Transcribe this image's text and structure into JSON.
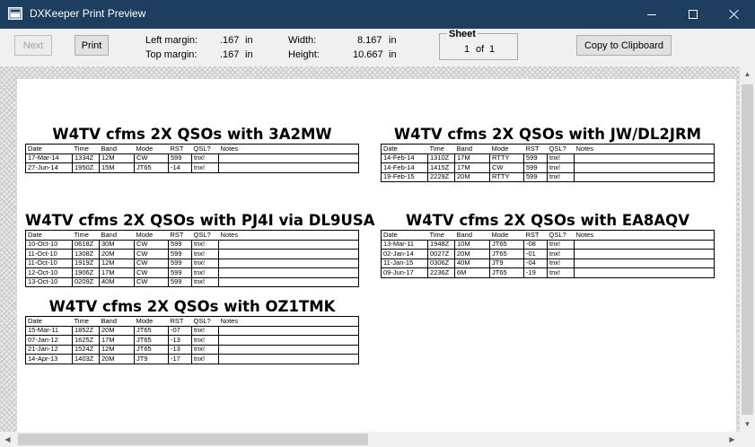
{
  "window": {
    "title": "DXKeeper Print Preview"
  },
  "toolbar": {
    "next_label": "Next",
    "print_label": "Print",
    "copy_label": "Copy to Clipboard",
    "left_margin_label": "Left margin:",
    "left_margin_value": ".167",
    "top_margin_label": "Top margin:",
    "top_margin_value": ".167",
    "width_label": "Width:",
    "width_value": "8.167",
    "height_label": "Height:",
    "height_value": "10.667",
    "unit": "in",
    "sheet_label": "Sheet",
    "sheet_current": "1",
    "sheet_of": "of",
    "sheet_total": "1"
  },
  "columns": [
    "Date",
    "Time",
    "Band",
    "Mode",
    "RST",
    "QSL?",
    "Notes"
  ],
  "qsls": [
    {
      "title": "W4TV cfms 2X QSOs with 3A2MW",
      "rows": [
        [
          "17-Mar-14",
          "1334Z",
          "12M",
          "CW",
          "599",
          "tnx!",
          ""
        ],
        [
          "27-Jun-14",
          "1950Z",
          "15M",
          "JT65",
          "-14",
          "tnx!",
          ""
        ]
      ]
    },
    {
      "title": "W4TV cfms 2X QSOs with JW/DL2JRM",
      "rows": [
        [
          "14-Feb-14",
          "1310Z",
          "17M",
          "RTTY",
          "599",
          "tnx!",
          ""
        ],
        [
          "14-Feb-14",
          "1415Z",
          "17M",
          "CW",
          "599",
          "tnx!",
          ""
        ],
        [
          "19-Feb-15",
          "2229Z",
          "20M",
          "RTTY",
          "599",
          "tnx!",
          ""
        ]
      ]
    },
    {
      "title": "W4TV cfms 2X QSOs with PJ4I via DL9USA",
      "rows": [
        [
          "10-Oct-10",
          "0618Z",
          "30M",
          "CW",
          "599",
          "tnx!",
          ""
        ],
        [
          "11-Oct-10",
          "1308Z",
          "20M",
          "CW",
          "599",
          "tnx!",
          ""
        ],
        [
          "11-Oct-10",
          "1919Z",
          "12M",
          "CW",
          "599",
          "tnx!",
          ""
        ],
        [
          "12-Oct-10",
          "1906Z",
          "17M",
          "CW",
          "599",
          "tnx!",
          ""
        ],
        [
          "13-Oct-10",
          "0209Z",
          "40M",
          "CW",
          "599",
          "tnx!",
          ""
        ]
      ]
    },
    {
      "title": "W4TV cfms 2X QSOs with EA8AQV",
      "rows": [
        [
          "13-Mar-11",
          "1948Z",
          "10M",
          "JT65",
          "-08",
          "tnx!",
          ""
        ],
        [
          "02-Jan-14",
          "0027Z",
          "20M",
          "JT65",
          "-01",
          "tnx!",
          ""
        ],
        [
          "11-Jan-15",
          "0306Z",
          "40M",
          "JT9",
          "-04",
          "tnx!",
          ""
        ],
        [
          "09-Jun-17",
          "2236Z",
          "6M",
          "JT65",
          "-19",
          "tnx!",
          ""
        ]
      ]
    },
    {
      "title": "W4TV cfms 2X QSOs with OZ1TMK",
      "rows": [
        [
          "15-Mar-11",
          "1852Z",
          "20M",
          "JT65",
          "-07",
          "tnx!",
          ""
        ],
        [
          "07-Jan-12",
          "1625Z",
          "17M",
          "JT65",
          "-13",
          "tnx!",
          ""
        ],
        [
          "21-Jan-12",
          "1524Z",
          "12M",
          "JT65",
          "-13",
          "tnx!",
          ""
        ],
        [
          "14-Apr-13",
          "1403Z",
          "20M",
          "JT9",
          "-17",
          "tnx!",
          ""
        ]
      ]
    }
  ],
  "colors": {
    "titlebar": "#1d3e5e",
    "toolbar": "#f0f0f0"
  }
}
